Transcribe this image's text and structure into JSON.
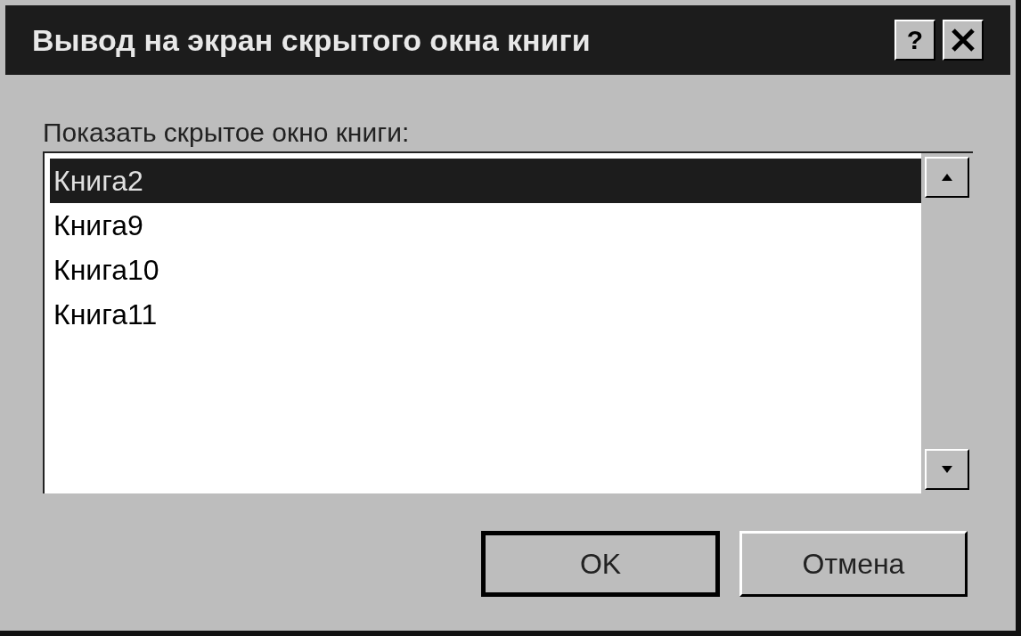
{
  "window": {
    "title": "Вывод на экран скрытого окна книги",
    "help_button": "?"
  },
  "list_label": "Показать скрытое окно книги:",
  "list_items": [
    {
      "label": "Книга2",
      "selected": true
    },
    {
      "label": "Книга9",
      "selected": false
    },
    {
      "label": "Книга10",
      "selected": false
    },
    {
      "label": "Книга11",
      "selected": false
    }
  ],
  "buttons": [
    {
      "label": "OK",
      "default": true
    },
    {
      "label": "Отмена",
      "default": false
    }
  ]
}
